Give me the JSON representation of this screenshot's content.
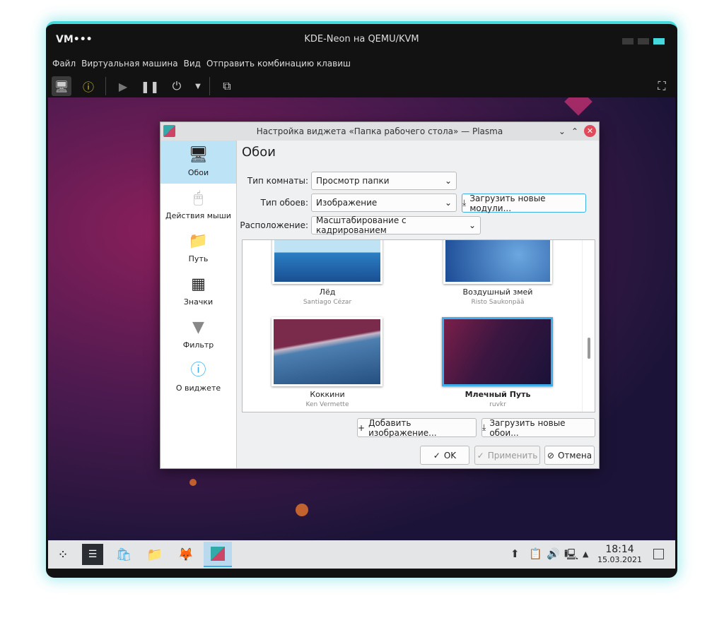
{
  "vm": {
    "logo": "VM•••",
    "title": "KDE-Neon на QEMU/KVM",
    "menu": [
      "Файл",
      "Виртуальная машина",
      "Вид",
      "Отправить комбинацию клавиш"
    ]
  },
  "dialog": {
    "title": "Настройка виджета «Папка рабочего стола» — Plasma",
    "sidebar": [
      "Обои",
      "Действия мыши",
      "Путь",
      "Значки",
      "Фильтр",
      "О виджете"
    ],
    "heading": "Обои",
    "layout_label": "Тип комнаты:",
    "layout_value": "Просмотр папки",
    "type_label": "Тип обоев:",
    "type_value": "Изображение",
    "get_plugins": "Загрузить новые модули...",
    "position_label": "Расположение:",
    "position_value": "Масштабирование с кадрированием",
    "wallpapers": [
      {
        "name": "Лёд",
        "author": "Santiago Cézar"
      },
      {
        "name": "Воздушный змей",
        "author": "Risto Saukonpää"
      },
      {
        "name": "Коккини",
        "author": "Ken Vermette"
      },
      {
        "name": "Млечный Путь",
        "author": "ruvkr"
      }
    ],
    "add_image": "Добавить изображение...",
    "get_wallpapers": "Загрузить новые обои...",
    "ok": "OK",
    "apply": "Применить",
    "cancel": "Отмена"
  },
  "tray": {
    "time": "18:14",
    "date": "15.03.2021"
  }
}
